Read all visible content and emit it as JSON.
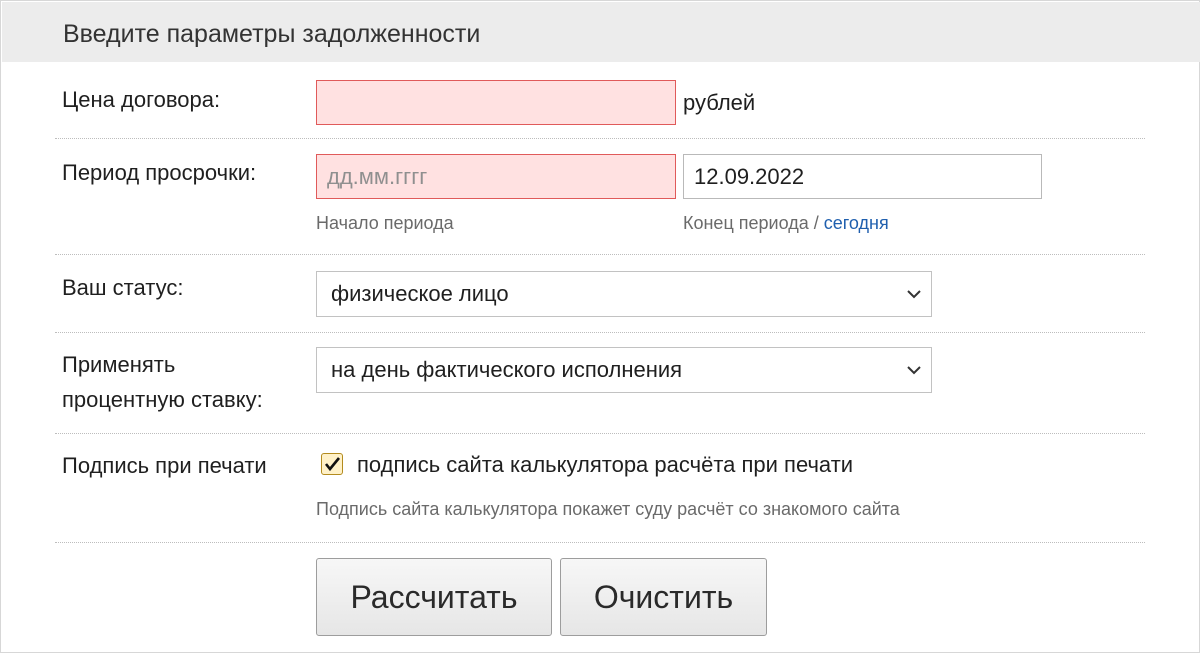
{
  "header": {
    "title": "Введите параметры задолженности"
  },
  "contract_price": {
    "label": "Цена договора:",
    "value": "",
    "unit": "рублей"
  },
  "period": {
    "label": "Период просрочки:",
    "start_placeholder": "дд.мм.гггг",
    "start_hint": "Начало периода",
    "end_value": "12.09.2022",
    "end_hint": "Конец периода /",
    "today_link": "сегодня"
  },
  "status": {
    "label": "Ваш статус:",
    "selected": "физическое лицо"
  },
  "rate": {
    "label_line1": "Применять",
    "label_line2": "процентную ставку:",
    "selected": "на день фактического исполнения"
  },
  "signature": {
    "label": "Подпись при печати",
    "checkbox_label": "подпись сайта калькулятора расчёта при печати",
    "checked": true,
    "hint": "Подпись сайта калькулятора покажет суду расчёт со знакомого сайта"
  },
  "buttons": {
    "calculate": "Рассчитать",
    "clear": "Очистить"
  },
  "colors": {
    "error_bg": "#ffe1e1",
    "error_border": "#e05a5a",
    "link": "#1f5fae",
    "header_bg": "#ececec"
  },
  "icons": {
    "dropdown": "chevron-down-icon",
    "checkbox": "checkmark-icon"
  }
}
